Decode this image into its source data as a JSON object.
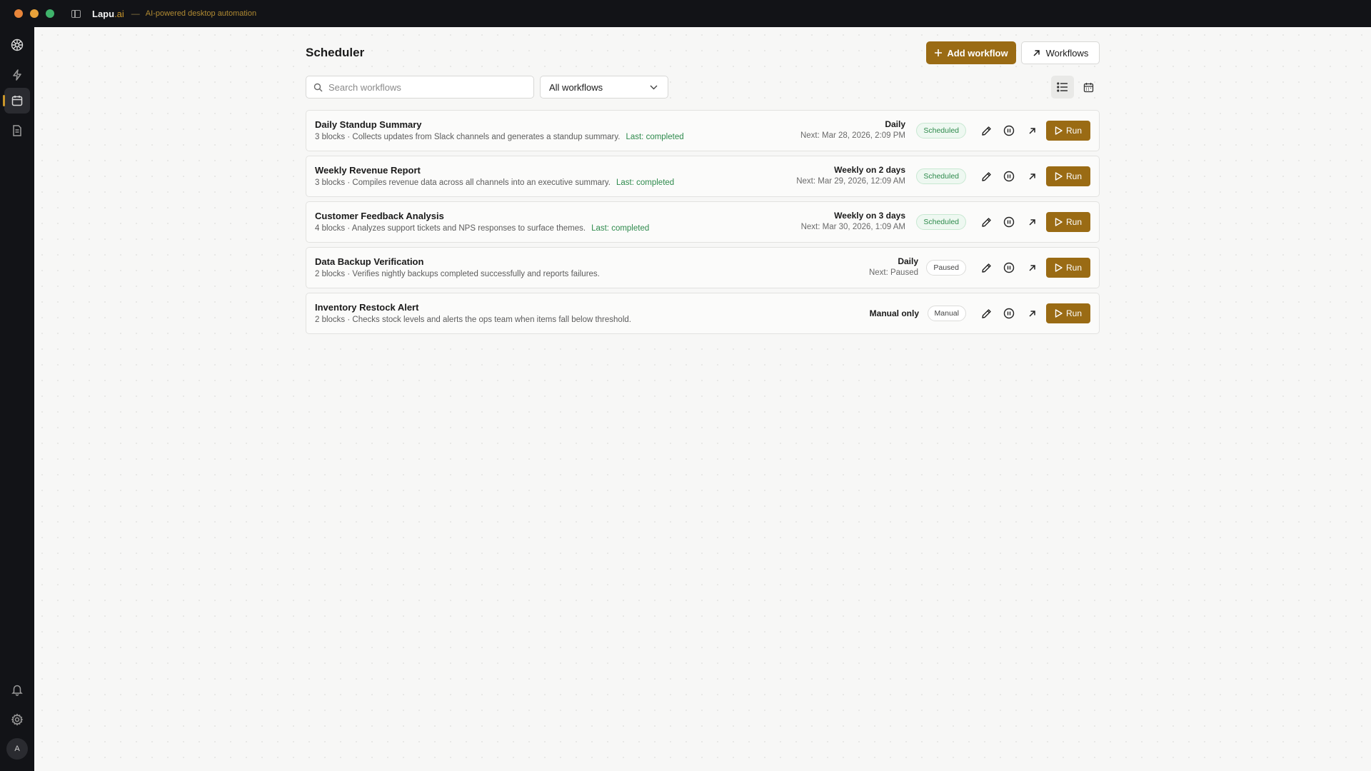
{
  "window": {
    "app_name": "Lapu",
    "app_suffix": ".ai",
    "separator": "—",
    "tagline": "AI-powered desktop automation",
    "traffic_colors": [
      "#e8853a",
      "#e8a23a",
      "#3fb36b"
    ]
  },
  "rail": {
    "items": [
      {
        "icon": "logo-icon",
        "active": false
      },
      {
        "icon": "lightning-icon",
        "active": false
      },
      {
        "icon": "calendar-icon",
        "active": true
      },
      {
        "icon": "document-icon",
        "active": false
      }
    ],
    "bottom": [
      {
        "icon": "bell-icon"
      },
      {
        "icon": "gear-icon"
      }
    ],
    "avatar_initial": "A"
  },
  "header": {
    "title": "Scheduler",
    "add_workflow_label": "Add workflow",
    "workflows_label": "Workflows"
  },
  "filters": {
    "search_placeholder": "Search workflows",
    "search_value": "",
    "select_value": "All workflows",
    "views": [
      "list-view",
      "calendar-view"
    ],
    "active_view": "list-view"
  },
  "colors": {
    "accent": "#9a6b14",
    "success": "#2e8a4c",
    "titlebar": "#121317"
  },
  "workflows": [
    {
      "name": "Daily Standup Summary",
      "blocks": "3 blocks",
      "description": "Collects updates from Slack channels and generates a standup summary.",
      "last": "Last: completed",
      "frequency": "Daily",
      "next": "Next: Mar 28, 2026, 2:09 PM",
      "status": "Scheduled",
      "run_label": "Run"
    },
    {
      "name": "Weekly Revenue Report",
      "blocks": "3 blocks",
      "description": "Compiles revenue data across all channels into an executive summary.",
      "last": "Last: completed",
      "frequency": "Weekly on 2 days",
      "next": "Next: Mar 29, 2026, 12:09 AM",
      "status": "Scheduled",
      "run_label": "Run"
    },
    {
      "name": "Customer Feedback Analysis",
      "blocks": "4 blocks",
      "description": "Analyzes support tickets and NPS responses to surface themes.",
      "last": "Last: completed",
      "frequency": "Weekly on 3 days",
      "next": "Next: Mar 30, 2026, 1:09 AM",
      "status": "Scheduled",
      "run_label": "Run"
    },
    {
      "name": "Data Backup Verification",
      "blocks": "2 blocks",
      "description": "Verifies nightly backups completed successfully and reports failures.",
      "last": "",
      "frequency": "Daily",
      "next": "Next: Paused",
      "status": "Paused",
      "run_label": "Run"
    },
    {
      "name": "Inventory Restock Alert",
      "blocks": "2 blocks",
      "description": "Checks stock levels and alerts the ops team when items fall below threshold.",
      "last": "",
      "frequency": "Manual only",
      "next": "",
      "status": "Manual",
      "run_label": "Run"
    }
  ]
}
